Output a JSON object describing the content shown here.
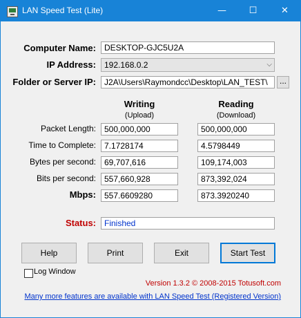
{
  "window": {
    "title": "LAN Speed Test (Lite)"
  },
  "titlebar": {
    "minimize": "—",
    "maximize": "☐",
    "close": "✕"
  },
  "form": {
    "computer_name_label": "Computer Name:",
    "computer_name_value": "DESKTOP-GJC5U2A",
    "ip_label": "IP Address:",
    "ip_value": "192.168.0.2",
    "folder_label": "Folder or Server IP:",
    "folder_value": "J2A\\Users\\Raymondcc\\Desktop\\LAN_TEST\\",
    "browse_label": "..."
  },
  "results": {
    "writing_header": "Writing",
    "writing_sub": "(Upload)",
    "reading_header": "Reading",
    "reading_sub": "(Download)",
    "rows": [
      {
        "label": "Packet Length:",
        "writing": "500,000,000",
        "reading": "500,000,000"
      },
      {
        "label": "Time to Complete:",
        "writing": "7.1728174",
        "reading": "4.5798449"
      },
      {
        "label": "Bytes per second:",
        "writing": "69,707,616",
        "reading": "109,174,003"
      },
      {
        "label": "Bits per second:",
        "writing": "557,660,928",
        "reading": "873,392,024"
      },
      {
        "label": "Mbps:",
        "writing": "557.6609280",
        "reading": "873.3920240"
      }
    ]
  },
  "status": {
    "label": "Status:",
    "value": "Finished"
  },
  "buttons": {
    "help": "Help",
    "print": "Print",
    "exit": "Exit",
    "start": "Start Test"
  },
  "log_window_label": "Log Window",
  "footer": {
    "version": "Version 1.3.2 © 2008-2015 Totusoft.com",
    "link": "Many more features are available with LAN Speed Test (Registered Version)"
  },
  "colors": {
    "titlebar": "#1883d7",
    "status_label": "#c00000",
    "status_value": "#0033cc",
    "version": "#c00000",
    "link": "#0033cc"
  }
}
